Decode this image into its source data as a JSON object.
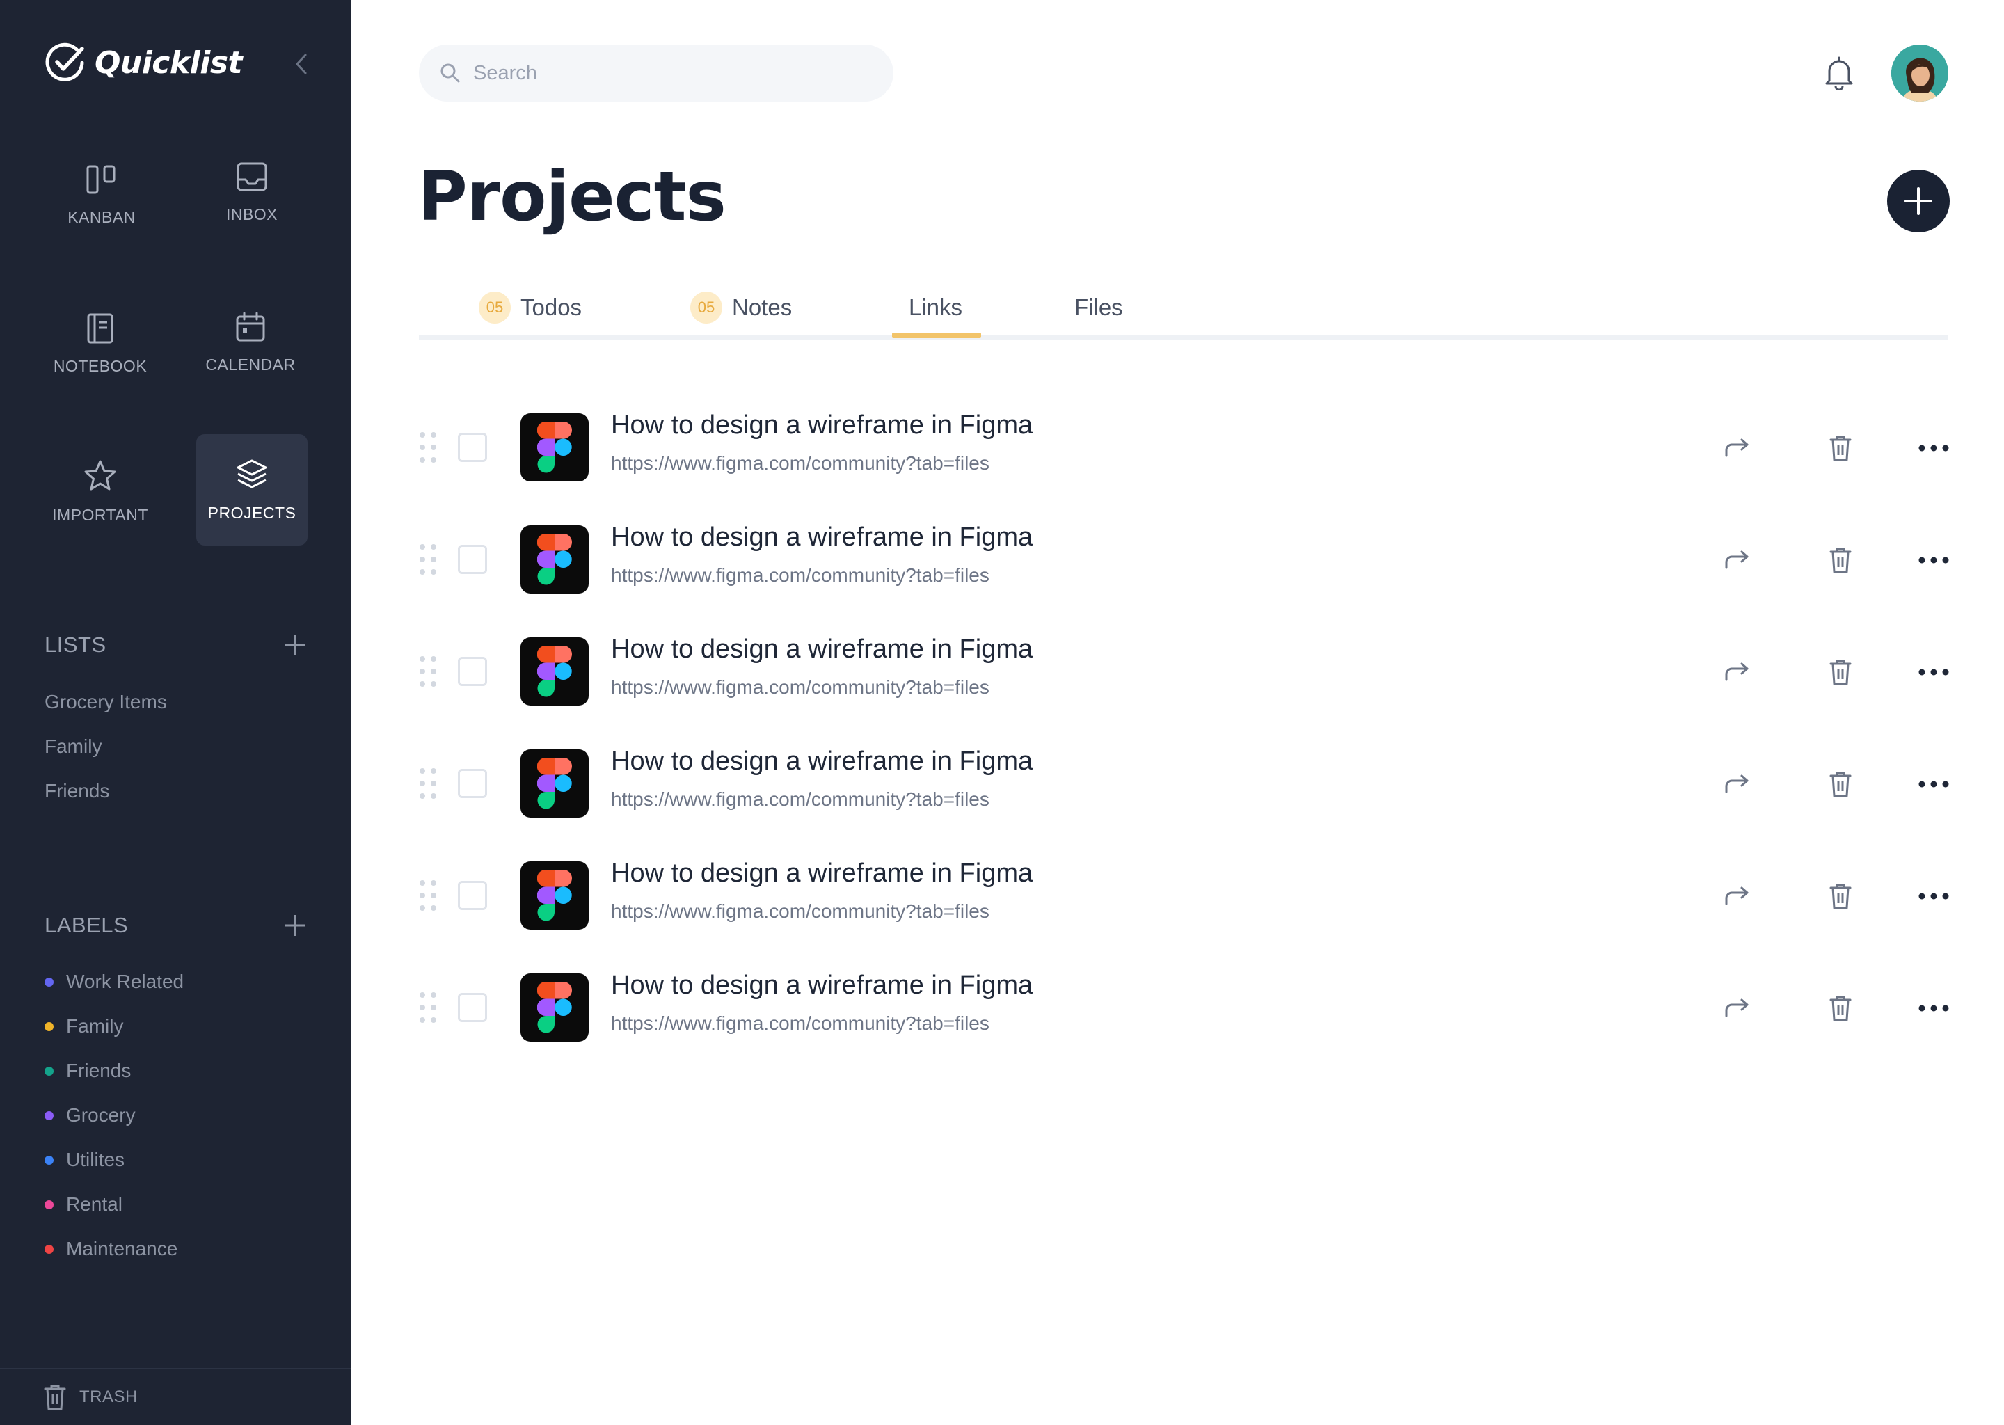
{
  "app": {
    "name": "Quicklist"
  },
  "nav": {
    "tiles": [
      {
        "label": "KANBAN",
        "icon": "kanban-icon"
      },
      {
        "label": "INBOX",
        "icon": "inbox-icon"
      },
      {
        "label": "NOTEBOOK",
        "icon": "notebook-icon"
      },
      {
        "label": "CALENDAR",
        "icon": "calendar-icon"
      },
      {
        "label": "IMPORTANT",
        "icon": "star-icon"
      },
      {
        "label": "PROJECTS",
        "icon": "layers-icon",
        "active": true
      }
    ]
  },
  "lists": {
    "title": "LISTS",
    "items": [
      "Grocery Items",
      "Family",
      "Friends"
    ]
  },
  "labels": {
    "title": "LABELS",
    "items": [
      {
        "name": "Work Related",
        "color": "#6366f1"
      },
      {
        "name": "Family",
        "color": "#f0b429"
      },
      {
        "name": "Friends",
        "color": "#14a38b"
      },
      {
        "name": "Grocery",
        "color": "#8b5cf6"
      },
      {
        "name": "Utilites",
        "color": "#3b82f6"
      },
      {
        "name": "Rental",
        "color": "#ec4899"
      },
      {
        "name": "Maintenance",
        "color": "#ef4444"
      }
    ]
  },
  "trash": {
    "label": "TRASH"
  },
  "search": {
    "placeholder": "Search",
    "value": ""
  },
  "page": {
    "title": "Projects"
  },
  "tabs": [
    {
      "label": "Todos",
      "count": "05"
    },
    {
      "label": "Notes",
      "count": "05"
    },
    {
      "label": "Links",
      "active": true
    },
    {
      "label": "Files"
    }
  ],
  "links": [
    {
      "title": "How to design a wireframe in Figma",
      "url": "https://www.figma.com/community?tab=files"
    },
    {
      "title": "How to design a wireframe in Figma",
      "url": "https://www.figma.com/community?tab=files"
    },
    {
      "title": "How to design a wireframe in Figma",
      "url": "https://www.figma.com/community?tab=files"
    },
    {
      "title": "How to design a wireframe in Figma",
      "url": "https://www.figma.com/community?tab=files"
    },
    {
      "title": "How to design a wireframe in Figma",
      "url": "https://www.figma.com/community?tab=files"
    },
    {
      "title": "How to design a wireframe in Figma",
      "url": "https://www.figma.com/community?tab=files"
    }
  ],
  "colors": {
    "sidebar_bg": "#1e2433",
    "accent": "#f2c46a",
    "primary_dark": "#1a2233"
  }
}
